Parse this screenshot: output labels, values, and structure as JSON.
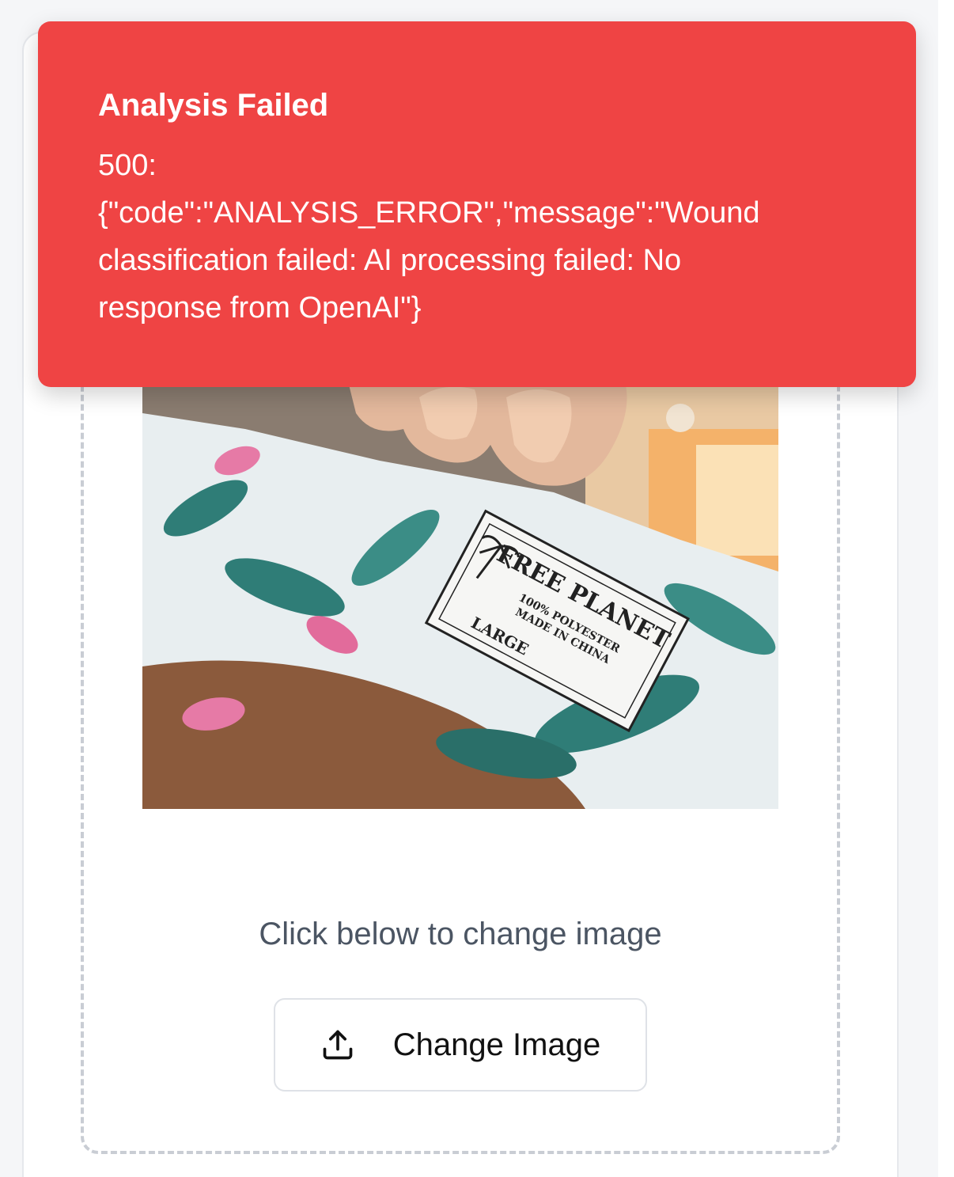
{
  "toast": {
    "title": "Analysis Failed",
    "message": "500:\n{\"code\":\"ANALYSIS_ERROR\",\"message\":\"Wound\nclassification failed: AI processing failed: No\nresponse from OpenAI\"}",
    "color": "#ef4444"
  },
  "upload": {
    "image_label": "FREE PLANET",
    "image_sub1": "100% POLYESTER",
    "image_sub2": "MADE IN CHINA",
    "image_size": "LARGE",
    "hint": "Click below to change image",
    "button_label": "Change Image",
    "button_icon": "upload-icon"
  }
}
